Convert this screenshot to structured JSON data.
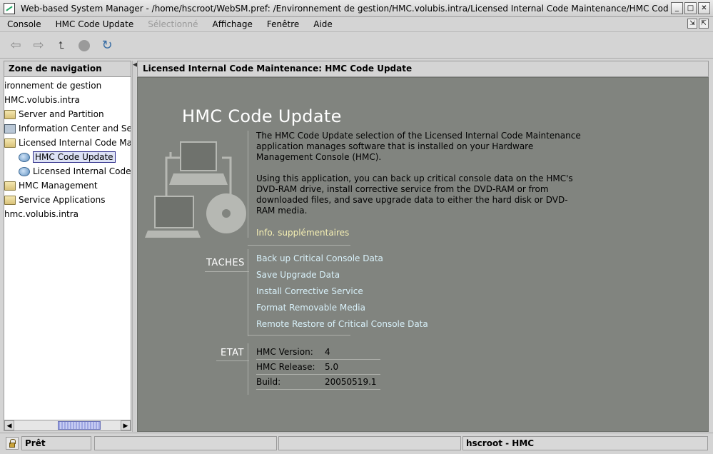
{
  "window": {
    "title": "Web-based System Manager - /home/hscroot/WebSM.pref: /Environnement de gestion/HMC.volubis.intra/Licensed Internal Code Maintenance/HMC Cod",
    "minimize_glyph": "_",
    "maximize_glyph": "□",
    "close_glyph": "✕"
  },
  "menubar": {
    "items": [
      {
        "label": "Console",
        "enabled": true
      },
      {
        "label": "HMC Code Update",
        "enabled": true
      },
      {
        "label": "Sélectionné",
        "enabled": false
      },
      {
        "label": "Affichage",
        "enabled": true
      },
      {
        "label": "Fenêtre",
        "enabled": true
      },
      {
        "label": "Aide",
        "enabled": true
      }
    ]
  },
  "toolbar": {
    "buttons": [
      {
        "icon": "back-arrow-icon",
        "glyph": "⇦"
      },
      {
        "icon": "forward-arrow-icon",
        "glyph": "⇨"
      },
      {
        "icon": "up-folder-icon",
        "glyph": "⮤"
      },
      {
        "icon": "stop-icon",
        "glyph": ""
      },
      {
        "icon": "refresh-icon",
        "glyph": "↻"
      }
    ]
  },
  "navigation": {
    "header": "Zone de navigation",
    "tree": [
      {
        "label": "ironnement de gestion",
        "icon": "none",
        "indent": 0
      },
      {
        "label": "HMC.volubis.intra",
        "icon": "none",
        "indent": 0
      },
      {
        "label": "Server and Partition",
        "icon": "folder-icon",
        "indent": 1
      },
      {
        "label": "Information Center and Setu",
        "icon": "computer-icon",
        "indent": 1
      },
      {
        "label": "Licensed Internal Code Mai",
        "icon": "folder-icon",
        "indent": 1
      },
      {
        "label": "HMC Code Update",
        "icon": "globe-icon",
        "indent": 2,
        "selected": true
      },
      {
        "label": "Licensed Internal Code",
        "icon": "globe-icon",
        "indent": 2
      },
      {
        "label": "HMC Management",
        "icon": "folder-icon",
        "indent": 1
      },
      {
        "label": "Service Applications",
        "icon": "folder-icon",
        "indent": 1
      },
      {
        "label": "hmc.volubis.intra",
        "icon": "none",
        "indent": 0
      }
    ]
  },
  "content": {
    "header": "Licensed Internal Code Maintenance: HMC Code Update",
    "title": "HMC Code Update",
    "description_1": "The HMC Code Update selection of the Licensed Internal Code Maintenance application manages software that is installed on your Hardware Management Console (HMC).",
    "description_2": "Using this application, you can back up critical console data on the HMC's DVD-RAM drive, install corrective service from the DVD-RAM or from downloaded files, and save upgrade data to either the hard disk or DVD-RAM media.",
    "more_info": "Info. supplémentaires",
    "tasks_label": "TACHES",
    "tasks": [
      "Back up Critical Console Data",
      "Save Upgrade Data",
      "Install Corrective Service",
      "Format Removable Media",
      "Remote Restore of Critical Console Data"
    ],
    "status_label": "ETAT",
    "status": [
      {
        "key": "HMC Version:",
        "value": "4"
      },
      {
        "key": "HMC Release:",
        "value": "5.0"
      },
      {
        "key": "Build:",
        "value": "20050519.1"
      }
    ]
  },
  "statusbar": {
    "state": "Prêt",
    "user": "hscroot - HMC"
  },
  "colors": {
    "content_background": "#81847f",
    "title_text": "#ffffff",
    "link_text": "#d8f1fa",
    "more_info_text": "#f6f0b4",
    "selection_background": "#dde2f5"
  }
}
